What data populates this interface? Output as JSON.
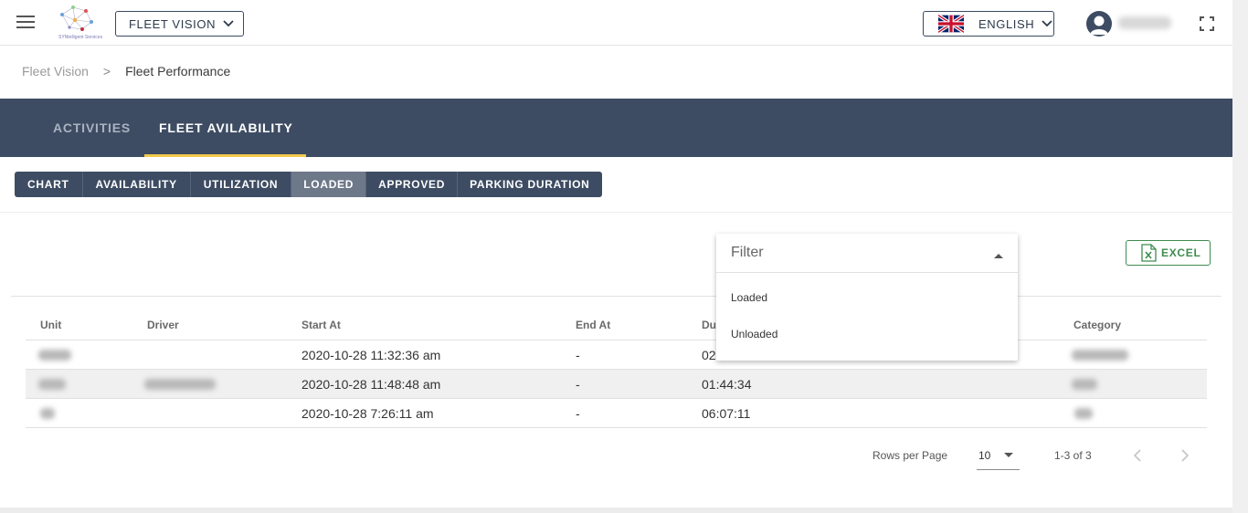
{
  "header": {
    "logo_text": "SYNtelligent Services",
    "app_selector": "FLEET VISION",
    "language": "ENGLISH"
  },
  "breadcrumb": {
    "root": "Fleet Vision",
    "separator": ">",
    "current": "Fleet Performance"
  },
  "main_tabs": [
    {
      "label": "ACTIVITIES",
      "active": false
    },
    {
      "label": "FLEET AVILABILITY",
      "active": true
    }
  ],
  "sub_tabs": [
    {
      "label": "CHART",
      "active": false
    },
    {
      "label": "AVAILABILITY",
      "active": false
    },
    {
      "label": "UTILIZATION",
      "active": false
    },
    {
      "label": "LOADED",
      "active": true
    },
    {
      "label": "APPROVED",
      "active": false
    },
    {
      "label": "PARKING DURATION",
      "active": false
    }
  ],
  "toolbar": {
    "excel_label": "EXCEL"
  },
  "filter": {
    "label": "Filter",
    "options": [
      "Loaded",
      "Unloaded"
    ]
  },
  "table": {
    "columns": [
      "Unit",
      "Driver",
      "Start At",
      "End At",
      "Du",
      "Category"
    ],
    "rows": [
      {
        "start_at": "2020-10-28 11:32:36 am",
        "end_at": "-",
        "duration": "02"
      },
      {
        "start_at": "2020-10-28 11:48:48 am",
        "end_at": "-",
        "duration": "01:44:34"
      },
      {
        "start_at": "2020-10-28 7:26:11 am",
        "end_at": "-",
        "duration": "06:07:11"
      }
    ]
  },
  "pagination": {
    "rows_per_page_label": "Rows per Page",
    "rows_per_page": "10",
    "range": "1-3 of 3"
  },
  "colors": {
    "banner": "#3d4c63",
    "tab_indicator": "#f2c94c",
    "excel_green": "#3f8c4f",
    "active_subtab": "#6d7889"
  },
  "icons": [
    "menu-icon",
    "chevron-down-icon",
    "uk-flag-icon",
    "user-avatar-icon",
    "fullscreen-icon",
    "excel-file-icon",
    "chevron-left-icon",
    "chevron-right-icon",
    "caret-up-icon",
    "caret-down-icon"
  ]
}
